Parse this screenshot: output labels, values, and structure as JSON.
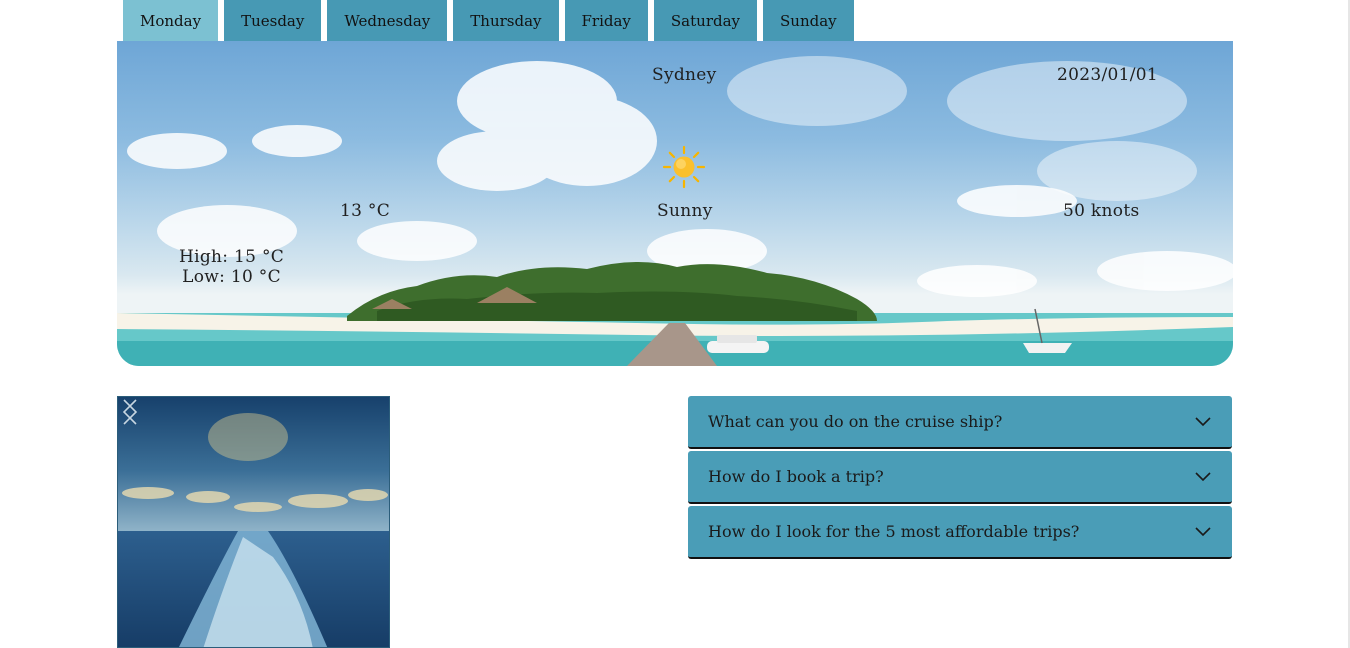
{
  "tabs": [
    {
      "label": "Monday",
      "active": true
    },
    {
      "label": "Tuesday"
    },
    {
      "label": "Wednesday"
    },
    {
      "label": "Thursday"
    },
    {
      "label": "Friday"
    },
    {
      "label": "Saturday"
    },
    {
      "label": "Sunday"
    }
  ],
  "weather": {
    "city": "Sydney",
    "date": "2023/01/01",
    "temperature": "13 °C",
    "condition": "Sunny",
    "condition_icon": "sun-icon",
    "wind": "50 knots",
    "high": "High: 15 °C",
    "low": "Low: 10 °C"
  },
  "carousel": {
    "prev_icon": "chevron-left-icon",
    "next_icon": "chevron-right-icon"
  },
  "faq": [
    {
      "question": "What can you do on the cruise ship?",
      "icon": "chevron-down-icon"
    },
    {
      "question": "How do I book a trip?",
      "icon": "chevron-down-icon"
    },
    {
      "question": "How do I look for the 5 most affordable trips?",
      "icon": "chevron-down-icon"
    }
  ],
  "colors": {
    "tab": "#4799b4",
    "tab_active": "#7cc1d2",
    "faq_bg": "#4a9db7"
  }
}
